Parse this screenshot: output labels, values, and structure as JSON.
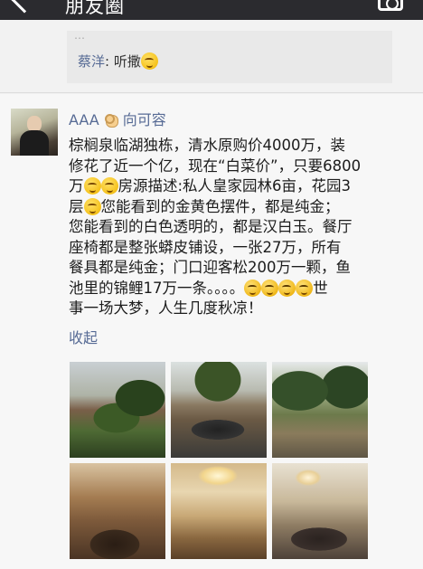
{
  "header": {
    "title": "朋友圈"
  },
  "previous_post": {
    "ghost_text": "…",
    "comment": {
      "user": "蔡洋",
      "separator": ": ",
      "text": "听撒"
    }
  },
  "post": {
    "author": "AAA",
    "reply_to": "向可容",
    "text_lines": [
      "棕榈泉临湖独栋，清水原购价4000万，装",
      "修花了近一个亿，现在“白菜价”，只要6800",
      "万",
      "房源描述:私人皇家园林6亩，花园3",
      "层",
      "您能看到的金黄色摆件，都是纯金；",
      "您能看到的白色透明的，都是汉白玉。餐厅",
      "座椅都是整张蟒皮铺设，一张27万，所有",
      "餐具都是纯金；门口迎客松200万一颗，鱼",
      "池里的锦鲤17万一条。。。。",
      "世",
      "事一场大梦，人生几度秋凉！"
    ],
    "collapse_label": "收起",
    "photos": [
      {
        "icon": "villa-exterior-photo"
      },
      {
        "icon": "garden-pond-photo"
      },
      {
        "icon": "garden-trees-photo"
      },
      {
        "icon": "living-room-photo"
      },
      {
        "icon": "dining-room-photo"
      },
      {
        "icon": "lounge-room-photo"
      }
    ]
  },
  "colors": {
    "link": "#576b95",
    "header_bg": "#2b2b2f",
    "page_bg": "#f7f7f7"
  }
}
